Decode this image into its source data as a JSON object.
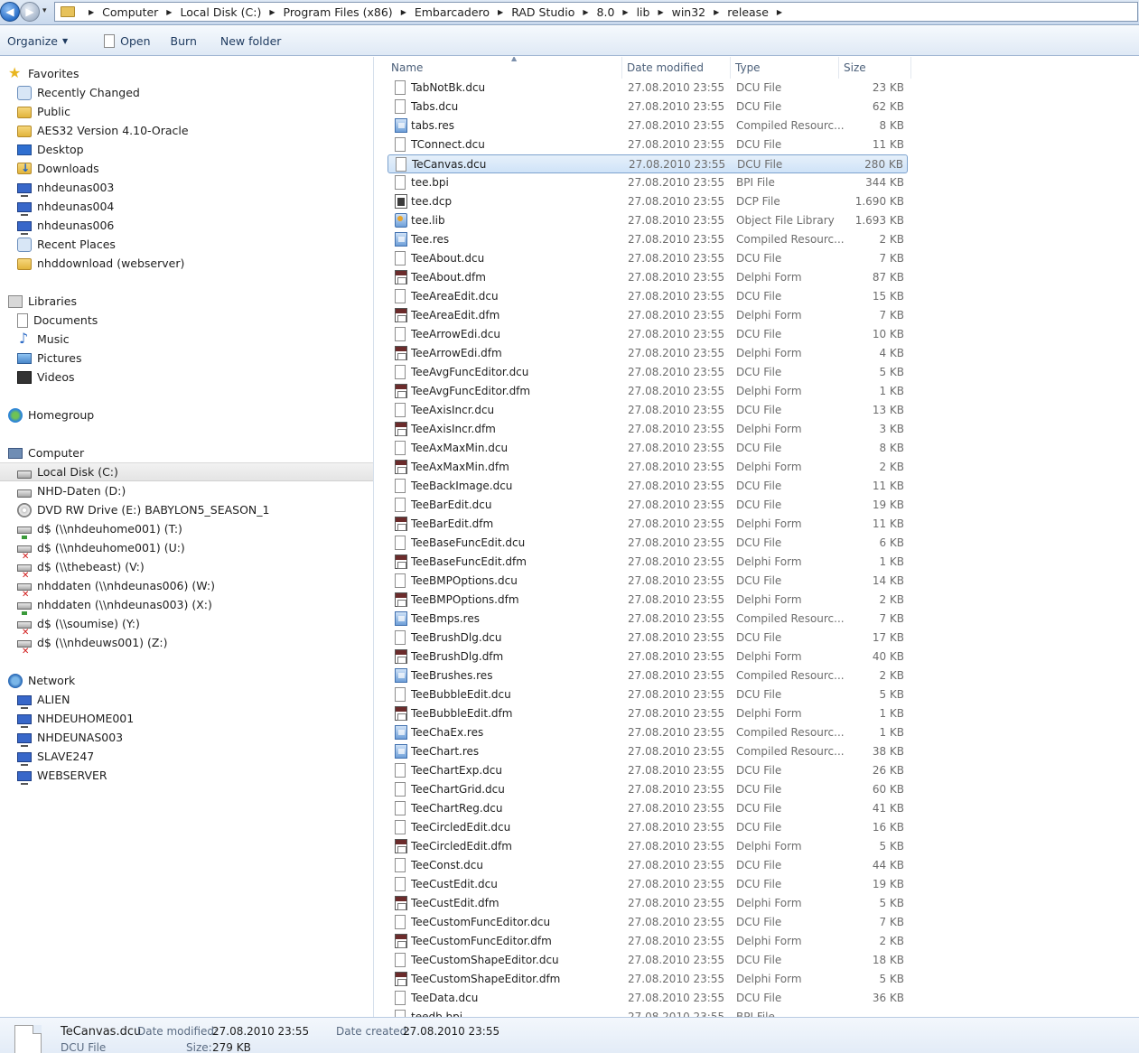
{
  "address": {
    "recent_locations": "▾",
    "crumbs": [
      "Computer",
      "Local Disk (C:)",
      "Program Files (x86)",
      "Embarcadero",
      "RAD Studio",
      "8.0",
      "lib",
      "win32",
      "release"
    ]
  },
  "toolbar": {
    "organize": "Organize",
    "open": "Open",
    "burn": "Burn",
    "new_folder": "New folder"
  },
  "nav": {
    "favorites_header": "Favorites",
    "favorites": [
      {
        "label": "Recently Changed",
        "icon": "recent-icon"
      },
      {
        "label": "Public",
        "icon": "folder-icon"
      },
      {
        "label": "AES32 Version 4.10-Oracle",
        "icon": "folder-icon"
      },
      {
        "label": "Desktop",
        "icon": "desktop-icon"
      },
      {
        "label": "Downloads",
        "icon": "downloads-icon"
      },
      {
        "label": "nhdeunas003",
        "icon": "network-computer-icon"
      },
      {
        "label": "nhdeunas004",
        "icon": "network-computer-icon"
      },
      {
        "label": "nhdeunas006",
        "icon": "network-computer-icon"
      },
      {
        "label": "Recent Places",
        "icon": "recent-places-icon"
      },
      {
        "label": "nhddownload (webserver)",
        "icon": "folder-icon"
      }
    ],
    "libraries_header": "Libraries",
    "libraries": [
      {
        "label": "Documents",
        "icon": "documents-icon"
      },
      {
        "label": "Music",
        "icon": "music-icon"
      },
      {
        "label": "Pictures",
        "icon": "pictures-icon"
      },
      {
        "label": "Videos",
        "icon": "videos-icon"
      }
    ],
    "homegroup": "Homegroup",
    "computer_header": "Computer",
    "drives": [
      {
        "label": "Local Disk (C:)",
        "icon": "disk-icon"
      },
      {
        "label": "NHD-Daten (D:)",
        "icon": "disk-icon"
      },
      {
        "label": "DVD RW Drive (E:) BABYLON5_SEASON_1",
        "icon": "dvd-icon"
      },
      {
        "label": "d$ (\\\\nhdeuhome001) (T:)",
        "icon": "network-drive-icon"
      },
      {
        "label": "d$ (\\\\nhdeuhome001) (U:)",
        "icon": "network-drive-disconnected-icon"
      },
      {
        "label": "d$ (\\\\thebeast) (V:)",
        "icon": "network-drive-disconnected-icon"
      },
      {
        "label": "nhddaten (\\\\nhdeunas006) (W:)",
        "icon": "network-drive-disconnected-icon"
      },
      {
        "label": "nhddaten (\\\\nhdeunas003) (X:)",
        "icon": "network-drive-icon"
      },
      {
        "label": "d$ (\\\\soumise) (Y:)",
        "icon": "network-drive-disconnected-icon"
      },
      {
        "label": "d$ (\\\\nhdeuws001) (Z:)",
        "icon": "network-drive-disconnected-icon"
      }
    ],
    "network_header": "Network",
    "network": [
      {
        "label": "ALIEN",
        "icon": "network-computer-icon"
      },
      {
        "label": "NHDEUHOME001",
        "icon": "network-computer-icon"
      },
      {
        "label": "NHDEUNAS003",
        "icon": "network-computer-icon"
      },
      {
        "label": "SLAVE247",
        "icon": "network-computer-icon"
      },
      {
        "label": "WEBSERVER",
        "icon": "network-computer-icon"
      }
    ]
  },
  "columns": {
    "name": "Name",
    "date": "Date modified",
    "type": "Type",
    "size": "Size"
  },
  "files": [
    {
      "name": "TabNotBk.dcu",
      "date": "27.08.2010 23:55",
      "type": "DCU File",
      "size": "23 KB",
      "icon": "dcu"
    },
    {
      "name": "Tabs.dcu",
      "date": "27.08.2010 23:55",
      "type": "DCU File",
      "size": "62 KB",
      "icon": "dcu"
    },
    {
      "name": "tabs.res",
      "date": "27.08.2010 23:55",
      "type": "Compiled Resourc...",
      "size": "8 KB",
      "icon": "res"
    },
    {
      "name": "TConnect.dcu",
      "date": "27.08.2010 23:55",
      "type": "DCU File",
      "size": "11 KB",
      "icon": "dcu"
    },
    {
      "name": "TeCanvas.dcu",
      "date": "27.08.2010 23:55",
      "type": "DCU File",
      "size": "280 KB",
      "icon": "dcu",
      "selected": true
    },
    {
      "name": "tee.bpi",
      "date": "27.08.2010 23:55",
      "type": "BPI File",
      "size": "344 KB",
      "icon": "dcu"
    },
    {
      "name": "tee.dcp",
      "date": "27.08.2010 23:55",
      "type": "DCP File",
      "size": "1.690 KB",
      "icon": "dcp"
    },
    {
      "name": "tee.lib",
      "date": "27.08.2010 23:55",
      "type": "Object File Library",
      "size": "1.693 KB",
      "icon": "lib"
    },
    {
      "name": "Tee.res",
      "date": "27.08.2010 23:55",
      "type": "Compiled Resourc...",
      "size": "2 KB",
      "icon": "res"
    },
    {
      "name": "TeeAbout.dcu",
      "date": "27.08.2010 23:55",
      "type": "DCU File",
      "size": "7 KB",
      "icon": "dcu"
    },
    {
      "name": "TeeAbout.dfm",
      "date": "27.08.2010 23:55",
      "type": "Delphi Form",
      "size": "87 KB",
      "icon": "dfm"
    },
    {
      "name": "TeeAreaEdit.dcu",
      "date": "27.08.2010 23:55",
      "type": "DCU File",
      "size": "15 KB",
      "icon": "dcu"
    },
    {
      "name": "TeeAreaEdit.dfm",
      "date": "27.08.2010 23:55",
      "type": "Delphi Form",
      "size": "7 KB",
      "icon": "dfm"
    },
    {
      "name": "TeeArrowEdi.dcu",
      "date": "27.08.2010 23:55",
      "type": "DCU File",
      "size": "10 KB",
      "icon": "dcu"
    },
    {
      "name": "TeeArrowEdi.dfm",
      "date": "27.08.2010 23:55",
      "type": "Delphi Form",
      "size": "4 KB",
      "icon": "dfm"
    },
    {
      "name": "TeeAvgFuncEditor.dcu",
      "date": "27.08.2010 23:55",
      "type": "DCU File",
      "size": "5 KB",
      "icon": "dcu"
    },
    {
      "name": "TeeAvgFuncEditor.dfm",
      "date": "27.08.2010 23:55",
      "type": "Delphi Form",
      "size": "1 KB",
      "icon": "dfm"
    },
    {
      "name": "TeeAxisIncr.dcu",
      "date": "27.08.2010 23:55",
      "type": "DCU File",
      "size": "13 KB",
      "icon": "dcu"
    },
    {
      "name": "TeeAxisIncr.dfm",
      "date": "27.08.2010 23:55",
      "type": "Delphi Form",
      "size": "3 KB",
      "icon": "dfm"
    },
    {
      "name": "TeeAxMaxMin.dcu",
      "date": "27.08.2010 23:55",
      "type": "DCU File",
      "size": "8 KB",
      "icon": "dcu"
    },
    {
      "name": "TeeAxMaxMin.dfm",
      "date": "27.08.2010 23:55",
      "type": "Delphi Form",
      "size": "2 KB",
      "icon": "dfm"
    },
    {
      "name": "TeeBackImage.dcu",
      "date": "27.08.2010 23:55",
      "type": "DCU File",
      "size": "11 KB",
      "icon": "dcu"
    },
    {
      "name": "TeeBarEdit.dcu",
      "date": "27.08.2010 23:55",
      "type": "DCU File",
      "size": "19 KB",
      "icon": "dcu"
    },
    {
      "name": "TeeBarEdit.dfm",
      "date": "27.08.2010 23:55",
      "type": "Delphi Form",
      "size": "11 KB",
      "icon": "dfm"
    },
    {
      "name": "TeeBaseFuncEdit.dcu",
      "date": "27.08.2010 23:55",
      "type": "DCU File",
      "size": "6 KB",
      "icon": "dcu"
    },
    {
      "name": "TeeBaseFuncEdit.dfm",
      "date": "27.08.2010 23:55",
      "type": "Delphi Form",
      "size": "1 KB",
      "icon": "dfm"
    },
    {
      "name": "TeeBMPOptions.dcu",
      "date": "27.08.2010 23:55",
      "type": "DCU File",
      "size": "14 KB",
      "icon": "dcu"
    },
    {
      "name": "TeeBMPOptions.dfm",
      "date": "27.08.2010 23:55",
      "type": "Delphi Form",
      "size": "2 KB",
      "icon": "dfm"
    },
    {
      "name": "TeeBmps.res",
      "date": "27.08.2010 23:55",
      "type": "Compiled Resourc...",
      "size": "7 KB",
      "icon": "res"
    },
    {
      "name": "TeeBrushDlg.dcu",
      "date": "27.08.2010 23:55",
      "type": "DCU File",
      "size": "17 KB",
      "icon": "dcu"
    },
    {
      "name": "TeeBrushDlg.dfm",
      "date": "27.08.2010 23:55",
      "type": "Delphi Form",
      "size": "40 KB",
      "icon": "dfm"
    },
    {
      "name": "TeeBrushes.res",
      "date": "27.08.2010 23:55",
      "type": "Compiled Resourc...",
      "size": "2 KB",
      "icon": "res"
    },
    {
      "name": "TeeBubbleEdit.dcu",
      "date": "27.08.2010 23:55",
      "type": "DCU File",
      "size": "5 KB",
      "icon": "dcu"
    },
    {
      "name": "TeeBubbleEdit.dfm",
      "date": "27.08.2010 23:55",
      "type": "Delphi Form",
      "size": "1 KB",
      "icon": "dfm"
    },
    {
      "name": "TeeChaEx.res",
      "date": "27.08.2010 23:55",
      "type": "Compiled Resourc...",
      "size": "1 KB",
      "icon": "res"
    },
    {
      "name": "TeeChart.res",
      "date": "27.08.2010 23:55",
      "type": "Compiled Resourc...",
      "size": "38 KB",
      "icon": "res"
    },
    {
      "name": "TeeChartExp.dcu",
      "date": "27.08.2010 23:55",
      "type": "DCU File",
      "size": "26 KB",
      "icon": "dcu"
    },
    {
      "name": "TeeChartGrid.dcu",
      "date": "27.08.2010 23:55",
      "type": "DCU File",
      "size": "60 KB",
      "icon": "dcu"
    },
    {
      "name": "TeeChartReg.dcu",
      "date": "27.08.2010 23:55",
      "type": "DCU File",
      "size": "41 KB",
      "icon": "dcu"
    },
    {
      "name": "TeeCircledEdit.dcu",
      "date": "27.08.2010 23:55",
      "type": "DCU File",
      "size": "16 KB",
      "icon": "dcu"
    },
    {
      "name": "TeeCircledEdit.dfm",
      "date": "27.08.2010 23:55",
      "type": "Delphi Form",
      "size": "5 KB",
      "icon": "dfm"
    },
    {
      "name": "TeeConst.dcu",
      "date": "27.08.2010 23:55",
      "type": "DCU File",
      "size": "44 KB",
      "icon": "dcu"
    },
    {
      "name": "TeeCustEdit.dcu",
      "date": "27.08.2010 23:55",
      "type": "DCU File",
      "size": "19 KB",
      "icon": "dcu"
    },
    {
      "name": "TeeCustEdit.dfm",
      "date": "27.08.2010 23:55",
      "type": "Delphi Form",
      "size": "5 KB",
      "icon": "dfm"
    },
    {
      "name": "TeeCustomFuncEditor.dcu",
      "date": "27.08.2010 23:55",
      "type": "DCU File",
      "size": "7 KB",
      "icon": "dcu"
    },
    {
      "name": "TeeCustomFuncEditor.dfm",
      "date": "27.08.2010 23:55",
      "type": "Delphi Form",
      "size": "2 KB",
      "icon": "dfm"
    },
    {
      "name": "TeeCustomShapeEditor.dcu",
      "date": "27.08.2010 23:55",
      "type": "DCU File",
      "size": "18 KB",
      "icon": "dcu"
    },
    {
      "name": "TeeCustomShapeEditor.dfm",
      "date": "27.08.2010 23:55",
      "type": "Delphi Form",
      "size": "5 KB",
      "icon": "dfm"
    },
    {
      "name": "TeeData.dcu",
      "date": "27.08.2010 23:55",
      "type": "DCU File",
      "size": "36 KB",
      "icon": "dcu"
    },
    {
      "name": "teedb.bpi",
      "date": "27.08.2010 23:55",
      "type": "BPI File",
      "size": "",
      "icon": "dcu"
    }
  ],
  "details": {
    "name": "TeCanvas.dcu",
    "type": "DCU File",
    "date_modified_label": "Date modified:",
    "date_modified": "27.08.2010 23:55",
    "size_label": "Size:",
    "size": "279 KB",
    "date_created_label": "Date created:",
    "date_created": "27.08.2010 23:55"
  }
}
